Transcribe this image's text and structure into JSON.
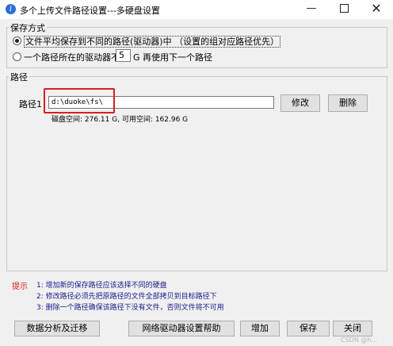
{
  "window": {
    "title": "多个上传文件路径设置---多硬盘设置",
    "app_icon": "info-icon",
    "controls": {
      "minimize": "—",
      "close": "✕"
    }
  },
  "save_mode": {
    "group_label": "保存方式",
    "option_even": "文件平均保存到不同的路径(驱动器)中 （设置的组对应路径优先）",
    "option_threshold_prefix": "一个路径所在的驱动器不足",
    "threshold_value": "5",
    "option_threshold_suffix": "G 再使用下一个路径",
    "selected": "option_even"
  },
  "paths": {
    "group_label": "路径",
    "path1": {
      "label": "路径1",
      "value": "d:\\duoke\\fs\\",
      "disk_info": "磁盘空间: 276.11 G, 可用空间: 162.96 G",
      "modify_label": "修改",
      "delete_label": "删除"
    }
  },
  "tips": {
    "label": "提示",
    "lines": [
      "1: 增加新的保存路径应该选择不同的硬盘",
      "2: 修改路径必须先把原路径的文件全部拷贝到目标路径下",
      "3: 删除一个路径确保该路径下没有文件，否则文件将不可用"
    ]
  },
  "buttons": {
    "data_analysis": "数据分析及迁移",
    "network_drive": "网络驱动器设置帮助",
    "add": "增加",
    "save": "保存",
    "close": "关闭"
  },
  "watermark": "CSDN @h...",
  "colors": {
    "highlight": "#d62020",
    "tip_text": "#1a1a8c",
    "tip_label": "#d62020"
  }
}
